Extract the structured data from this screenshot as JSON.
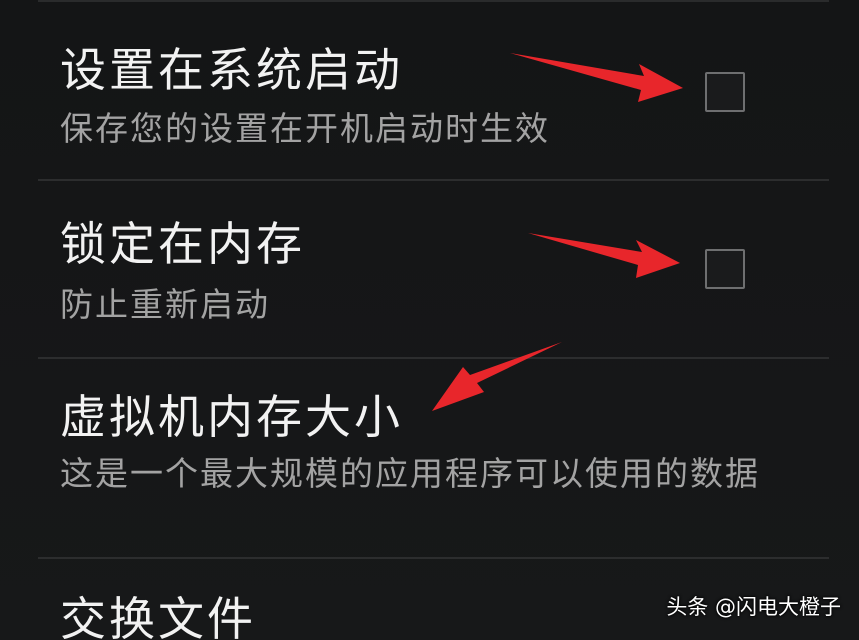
{
  "settings": {
    "items": [
      {
        "title": "设置在系统启动",
        "summary": "保存您的设置在开机启动时生效",
        "checkbox": {
          "checked": false
        }
      },
      {
        "title": "锁定在内存",
        "summary": "防止重新启动",
        "checkbox": {
          "checked": false
        }
      },
      {
        "title": "虚拟机内存大小",
        "summary": "这是一个最大规模的应用程序可以使用的数据"
      },
      {
        "title": "交换文件"
      }
    ]
  },
  "annotations": {
    "arrow_color": "#e8262b"
  },
  "watermark": {
    "text": "头条 @闪电大橙子"
  }
}
